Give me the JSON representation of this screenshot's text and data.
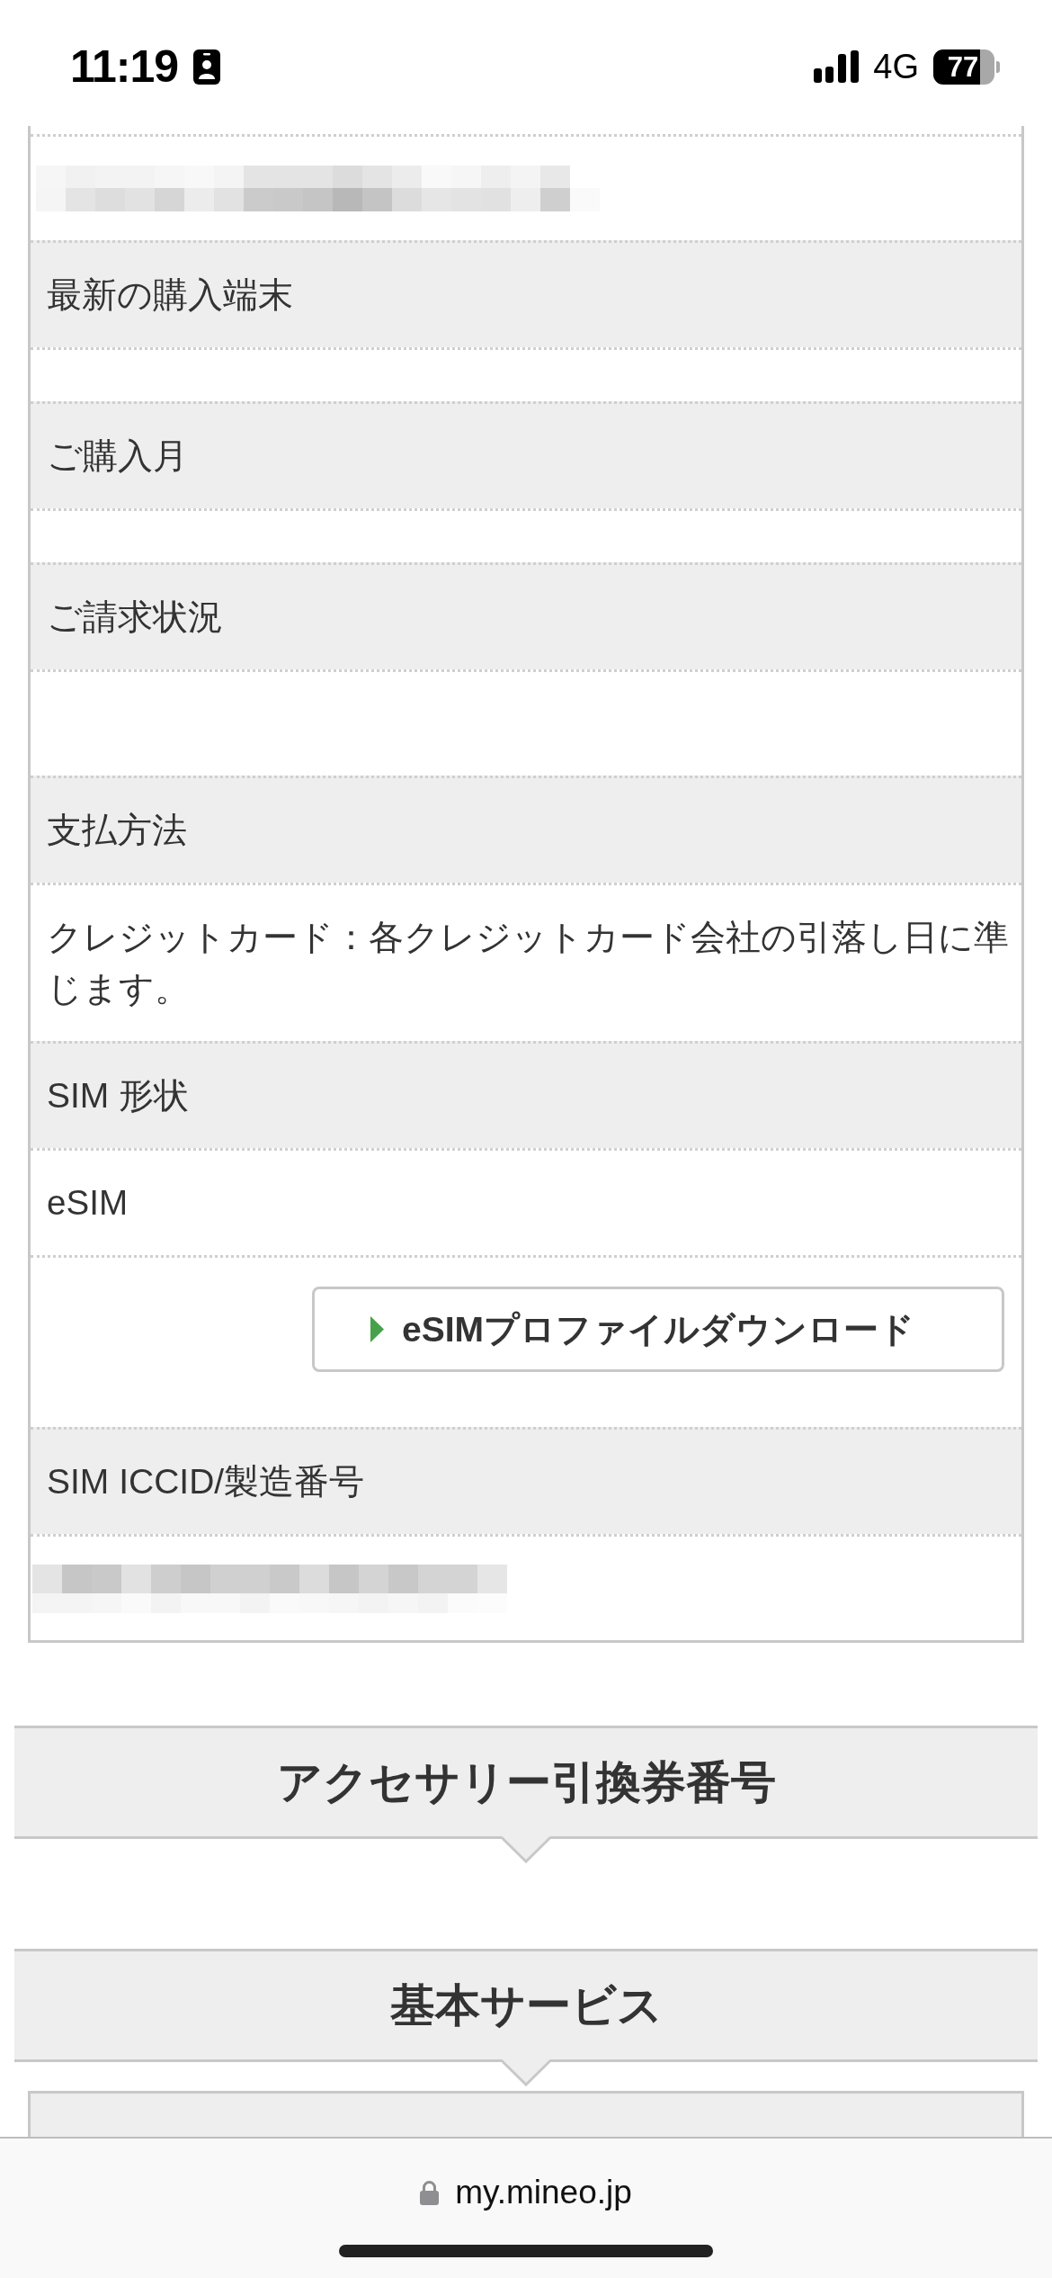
{
  "status_bar": {
    "time": "11:19",
    "network": "4G",
    "battery": "77"
  },
  "info_table": {
    "rows": [
      {
        "kind": "redacted"
      },
      {
        "kind": "label",
        "text": "最新の購入端末"
      },
      {
        "kind": "spacer"
      },
      {
        "kind": "label",
        "text": "ご購入月"
      },
      {
        "kind": "spacer"
      },
      {
        "kind": "label",
        "text": "ご請求状況"
      },
      {
        "kind": "empty"
      },
      {
        "kind": "label",
        "text": "支払方法"
      },
      {
        "kind": "value",
        "text": "クレジットカード：各クレジットカード会社の引落し日に準じます。"
      },
      {
        "kind": "label",
        "text": "SIM 形状"
      },
      {
        "kind": "value",
        "text": "eSIM"
      },
      {
        "kind": "button",
        "text": "eSIMプロファイルダウンロード"
      },
      {
        "kind": "label",
        "text": "SIM ICCID/製造番号"
      },
      {
        "kind": "redacted"
      }
    ]
  },
  "sections": [
    {
      "title": "アクセサリー引換券番号",
      "has_table": false
    },
    {
      "title": "基本サービス",
      "has_table": true
    }
  ],
  "browser_bar": {
    "url": "my.mineo.jp"
  }
}
